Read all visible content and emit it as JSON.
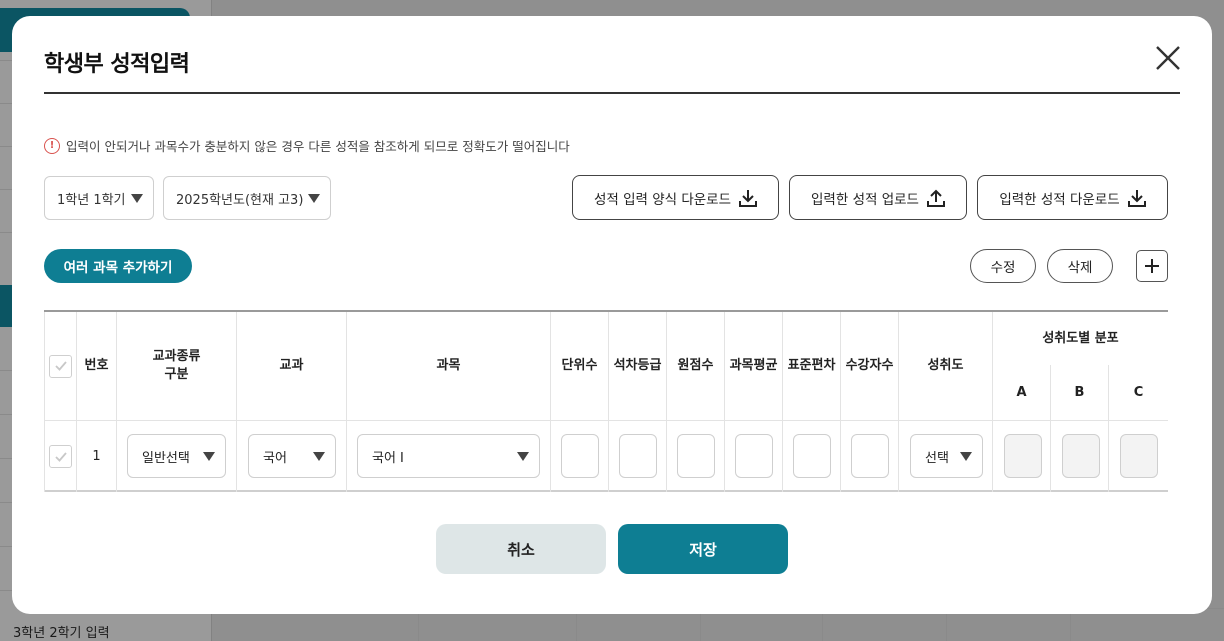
{
  "background": {
    "bottom_text": "3학년 2학기 입력"
  },
  "modal": {
    "title": "학생부 성적입력",
    "notice": "입력이 안되거나 과목수가 충분하지 않은 경우 다른 성적을 참조하게 되므로 정확도가 떨어집니다",
    "semester_select": "1학년 1학기",
    "year_select": "2025학년도(현재 고3)",
    "buttons": {
      "download_form": "성적 입력 양식 다운로드",
      "upload_scores": "입력한 성적 업로드",
      "download_scores": "입력한 성적 다운로드",
      "add_subjects": "여러 과목 추가하기",
      "edit": "수정",
      "delete": "삭제",
      "cancel": "취소",
      "save": "저장"
    },
    "table": {
      "headers": {
        "number": "번호",
        "subject_type": "교과종류\n구분",
        "course": "교과",
        "subject": "과목",
        "units": "단위수",
        "rank_grade": "석차등급",
        "raw_score": "원점수",
        "subject_avg": "과목평균",
        "std_dev": "표준편차",
        "students": "수강자수",
        "achievement": "성취도",
        "distribution": "성취도별 분포",
        "dist_a": "A",
        "dist_b": "B",
        "dist_c": "C"
      },
      "rows": [
        {
          "number": "1",
          "subject_type": "일반선택",
          "course": "국어",
          "subject": "국어 I",
          "achievement": "선택"
        }
      ]
    }
  },
  "colors": {
    "primary": "#0e7e93",
    "cancel_bg": "#dee6e7",
    "warning": "#d9534f"
  }
}
